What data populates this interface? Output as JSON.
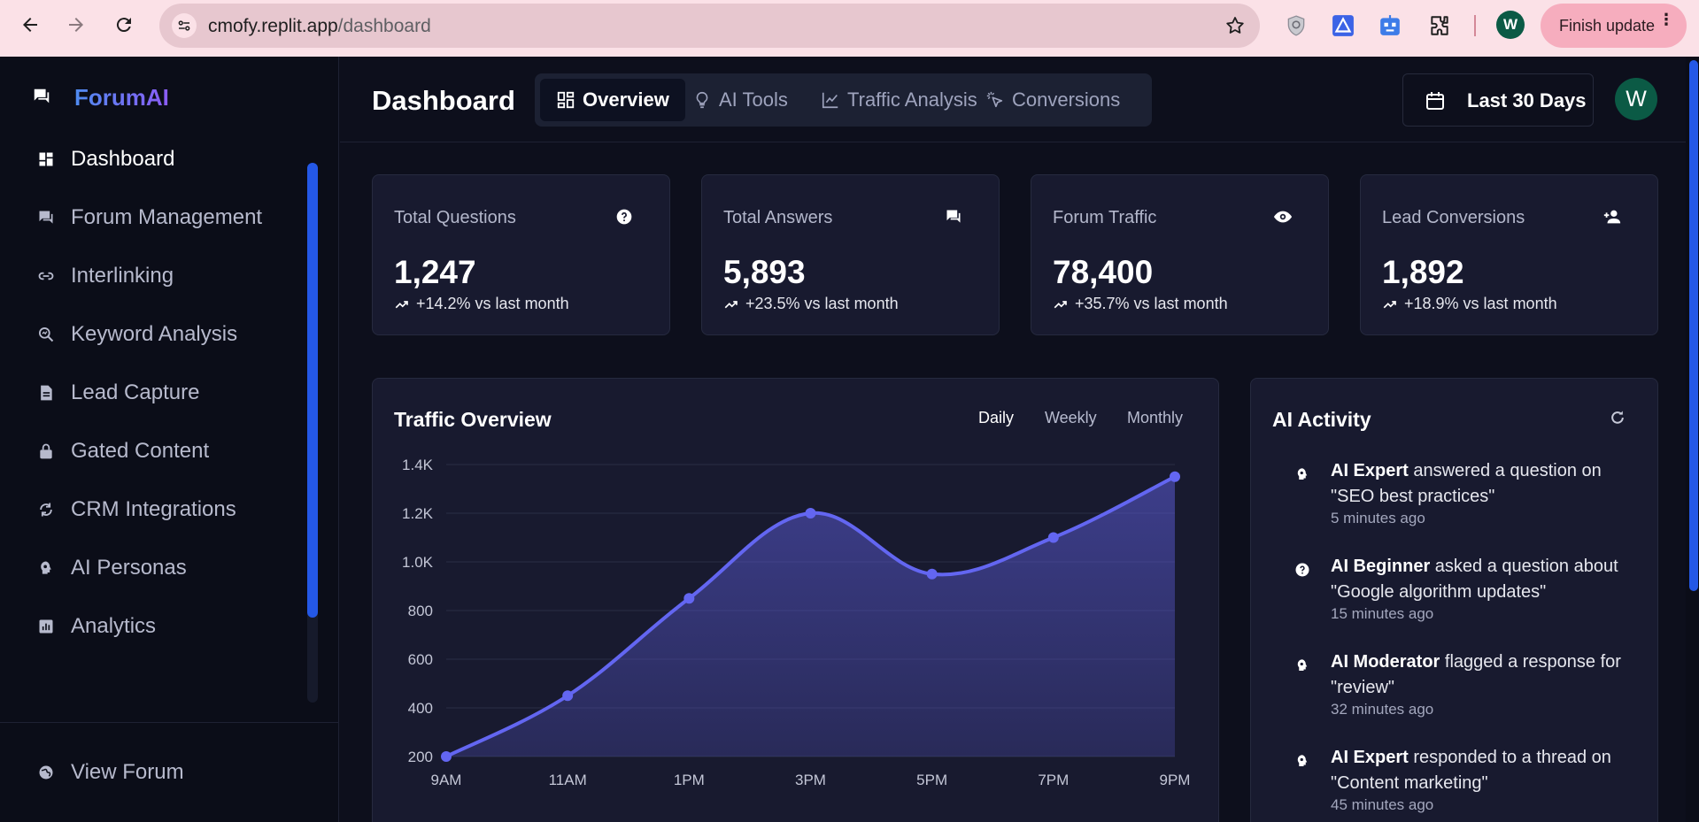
{
  "browser": {
    "url_host": "cmofy.replit.app",
    "url_path": "/dashboard",
    "profile_initial": "W",
    "update_button": "Finish update"
  },
  "sidebar": {
    "brand": "ForumAI",
    "items": [
      {
        "label": "Dashboard",
        "icon": "dashboard-icon",
        "active": true
      },
      {
        "label": "Forum Management",
        "icon": "forum-icon"
      },
      {
        "label": "Interlinking",
        "icon": "link-icon"
      },
      {
        "label": "Keyword Analysis",
        "icon": "keyword-search-icon"
      },
      {
        "label": "Lead Capture",
        "icon": "document-icon"
      },
      {
        "label": "Gated Content",
        "icon": "lock-icon"
      },
      {
        "label": "CRM Integrations",
        "icon": "sync-icon"
      },
      {
        "label": "AI Personas",
        "icon": "persona-icon"
      },
      {
        "label": "Analytics",
        "icon": "analytics-icon"
      }
    ],
    "footer_item": "View Forum"
  },
  "header": {
    "title": "Dashboard",
    "tabs": [
      {
        "label": "Overview",
        "icon": "grid-icon",
        "active": true
      },
      {
        "label": "AI Tools",
        "icon": "lightbulb-icon"
      },
      {
        "label": "Traffic Analysis",
        "icon": "line-chart-icon"
      },
      {
        "label": "Conversions",
        "icon": "sparkle-pointer-icon"
      }
    ],
    "date_range": "Last 30 Days",
    "avatar_initial": "W"
  },
  "stats": [
    {
      "label": "Total Questions",
      "value": "1,247",
      "change": "+14.2% vs last month",
      "icon": "question-icon"
    },
    {
      "label": "Total Answers",
      "value": "5,893",
      "change": "+23.5% vs last month",
      "icon": "chat-icon"
    },
    {
      "label": "Forum Traffic",
      "value": "78,400",
      "change": "+35.7% vs last month",
      "icon": "eye-icon"
    },
    {
      "label": "Lead Conversions",
      "value": "1,892",
      "change": "+18.9% vs last month",
      "icon": "add-user-icon"
    }
  ],
  "traffic": {
    "title": "Traffic Overview",
    "periods": [
      {
        "label": "Daily",
        "active": true
      },
      {
        "label": "Weekly"
      },
      {
        "label": "Monthly"
      }
    ]
  },
  "chart_data": {
    "type": "area",
    "title": "Traffic Overview",
    "categories": [
      "9AM",
      "11AM",
      "1PM",
      "3PM",
      "5PM",
      "7PM",
      "9PM"
    ],
    "values": [
      200,
      450,
      850,
      1200,
      950,
      1100,
      1350
    ],
    "yticks": [
      "200",
      "400",
      "600",
      "800",
      "1.0K",
      "1.2K",
      "1.4K"
    ],
    "ylim": [
      200,
      1400
    ],
    "grid": true,
    "line_color": "#6366f1"
  },
  "activity": {
    "title": "AI Activity",
    "items": [
      {
        "actor": "AI Expert",
        "text": " answered a question on \"SEO best practices\"",
        "time": "5 minutes ago",
        "icon": "persona-icon"
      },
      {
        "actor": "AI Beginner",
        "text": " asked a question about \"Google algorithm updates\"",
        "time": "15 minutes ago",
        "icon": "question-icon"
      },
      {
        "actor": "AI Moderator",
        "text": " flagged a response for \"review\"",
        "time": "32 minutes ago",
        "icon": "persona-icon"
      },
      {
        "actor": "AI Expert",
        "text": " responded to a thread on \"Content marketing\"",
        "time": "45 minutes ago",
        "icon": "persona-icon"
      }
    ]
  }
}
